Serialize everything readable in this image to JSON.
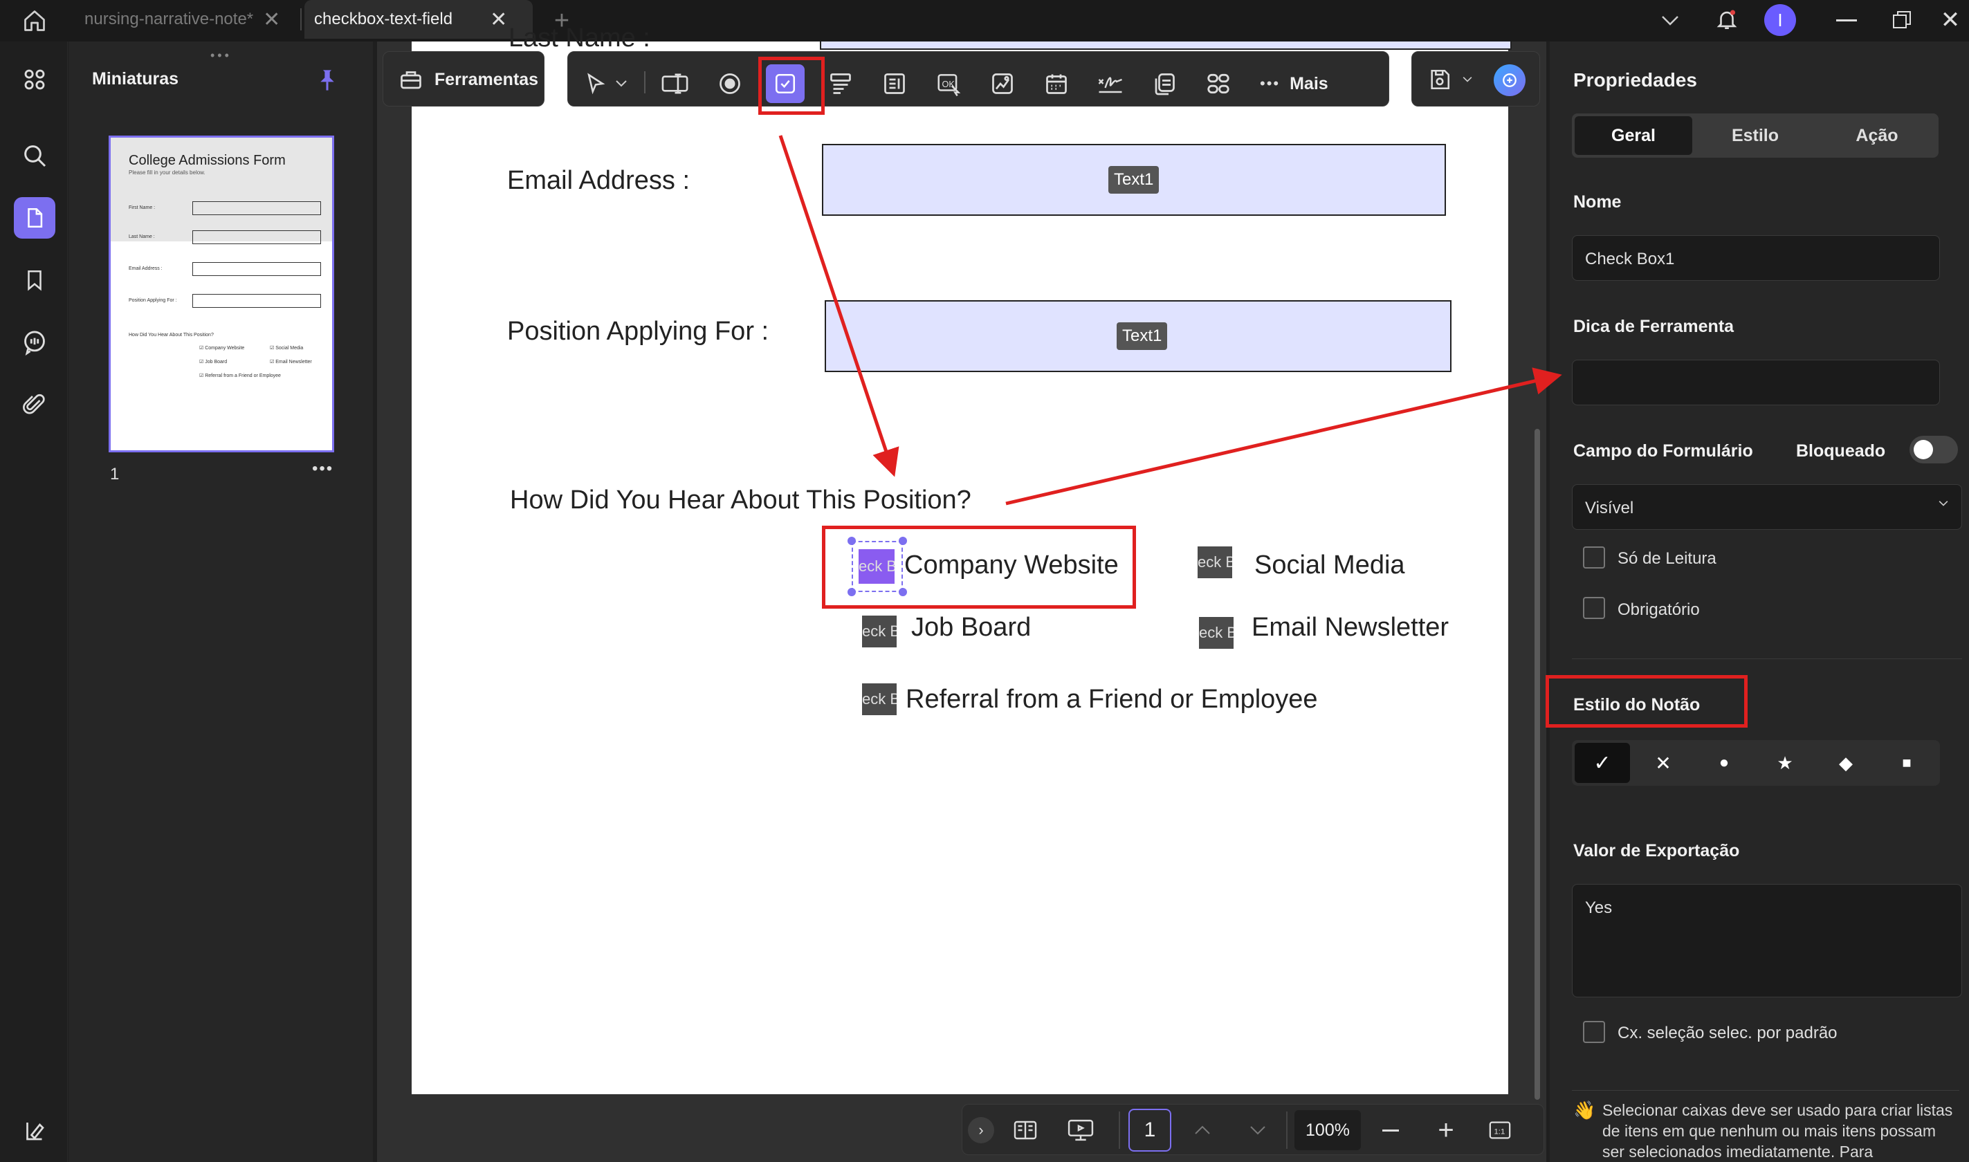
{
  "titlebar": {
    "tabs": [
      {
        "label": "nursing-narrative-note*"
      },
      {
        "label": "checkbox-text-field"
      }
    ],
    "user_initial": "I"
  },
  "sidebar": {
    "title": "Miniaturas",
    "page_number": "1",
    "thumb_title": "College Admissions Form",
    "thumb_subtitle": "Please fill in your details below.",
    "thumb_fields": [
      "First Name :",
      "Last Name :",
      "Email Address :",
      "Position Applying For :"
    ],
    "thumb_question": "How Did You Hear About This Position?",
    "thumb_options": [
      "Company Website",
      "Social Media",
      "Job Board",
      "Email Newsletter",
      "Referral from a Friend or Employee"
    ]
  },
  "toolbar": {
    "tools_label": "Ferramentas",
    "more_label": "Mais"
  },
  "document": {
    "top_partial_label": "Last Name :",
    "email_label": "Email Address :",
    "email_field_tag": "Text1",
    "position_label": "Position Applying For :",
    "position_field_tag": "Text1",
    "question": "How Did You Hear About This Position?",
    "checkbox_tag": "eck B",
    "options": {
      "company_website": "Company Website",
      "social_media": "Social Media",
      "job_board": "Job Board",
      "email_newsletter": "Email Newsletter",
      "referral": "Referral from a Friend or Employee"
    }
  },
  "bottombar": {
    "page_input": "1",
    "zoom": "100%"
  },
  "properties": {
    "title": "Propriedades",
    "tabs": [
      "Geral",
      "Estilo",
      "Ação"
    ],
    "name_label": "Nome",
    "name_value": "Check Box1",
    "tooltip_label": "Dica de Ferramenta",
    "tooltip_value": "",
    "form_field_label": "Campo do Formulário",
    "locked_label": "Bloqueado",
    "visibility_value": "Visível",
    "readonly_label": "Só de Leitura",
    "required_label": "Obrigatório",
    "button_style_label": "Estilo do Notão",
    "style_options": [
      "✓",
      "✕",
      "●",
      "★",
      "◆",
      "■"
    ],
    "export_label": "Valor de Exportação",
    "export_value": "Yes",
    "default_checked_label": "Cx. seleção selec. por padrão",
    "hint": "Selecionar caixas deve ser usado para criar listas de itens em que nenhum ou mais itens possam ser selecionados imediatamente. Para"
  },
  "colors": {
    "accent": "#7c6ff0",
    "annotation_red": "#e0201f",
    "field_fill": "#e0e3ff"
  }
}
